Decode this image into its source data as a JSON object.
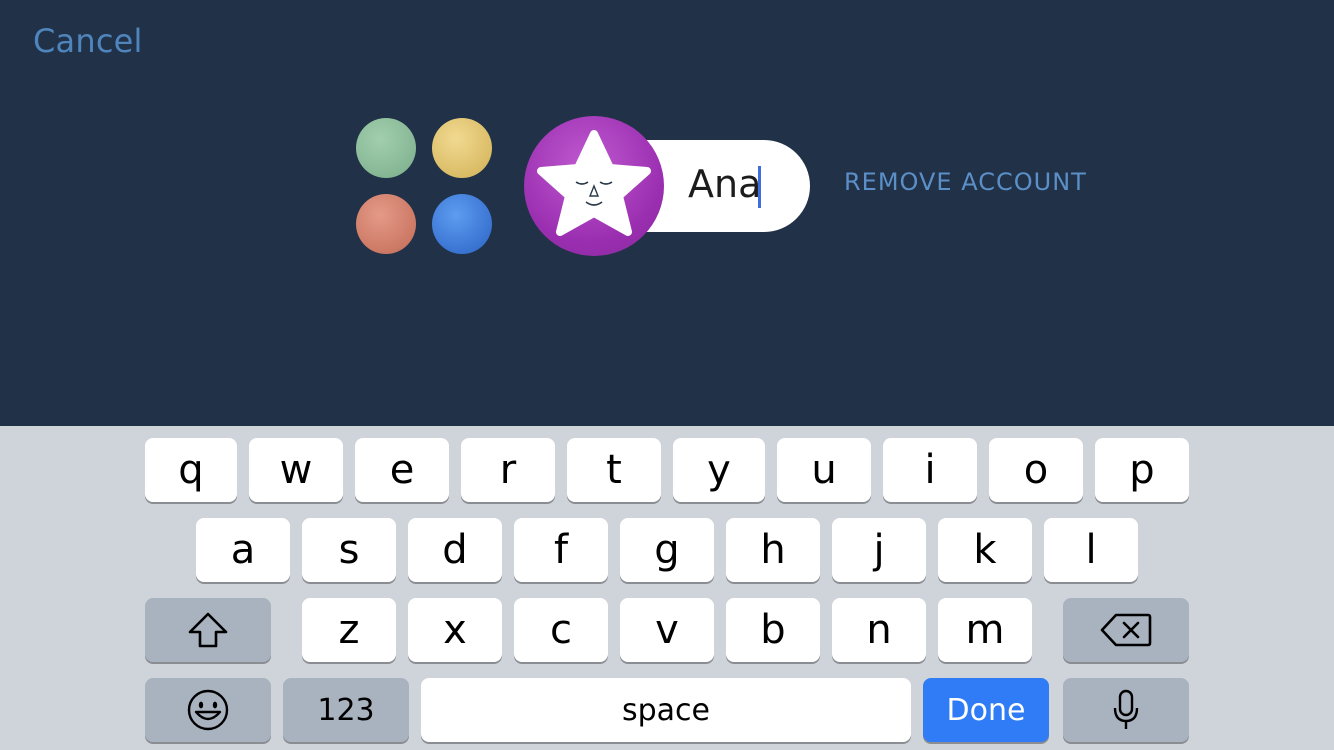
{
  "header": {
    "cancel_label": "Cancel",
    "remove_account_label": "REMOVE ACCOUNT"
  },
  "profile": {
    "name_value": "Ana",
    "avatar_icon": "sleeping-star-face-icon",
    "avatar_color": "#9a2eb0",
    "color_options": [
      {
        "name": "green",
        "color": "#86b795"
      },
      {
        "name": "yellow",
        "color": "#dbbd67"
      },
      {
        "name": "red",
        "color": "#cc7965"
      },
      {
        "name": "blue",
        "color": "#3a74d2"
      }
    ]
  },
  "keyboard": {
    "row1": [
      "q",
      "w",
      "e",
      "r",
      "t",
      "y",
      "u",
      "i",
      "o",
      "p"
    ],
    "row2": [
      "a",
      "s",
      "d",
      "f",
      "g",
      "h",
      "j",
      "k",
      "l"
    ],
    "row3": [
      "z",
      "x",
      "c",
      "v",
      "b",
      "n",
      "m"
    ],
    "shift_icon": "shift-icon",
    "backspace_icon": "backspace-icon",
    "emoji_icon": "emoji-icon",
    "mic_icon": "microphone-icon",
    "numbers_label": "123",
    "space_label": "space",
    "done_label": "Done",
    "done_color": "#2f7cf6"
  }
}
